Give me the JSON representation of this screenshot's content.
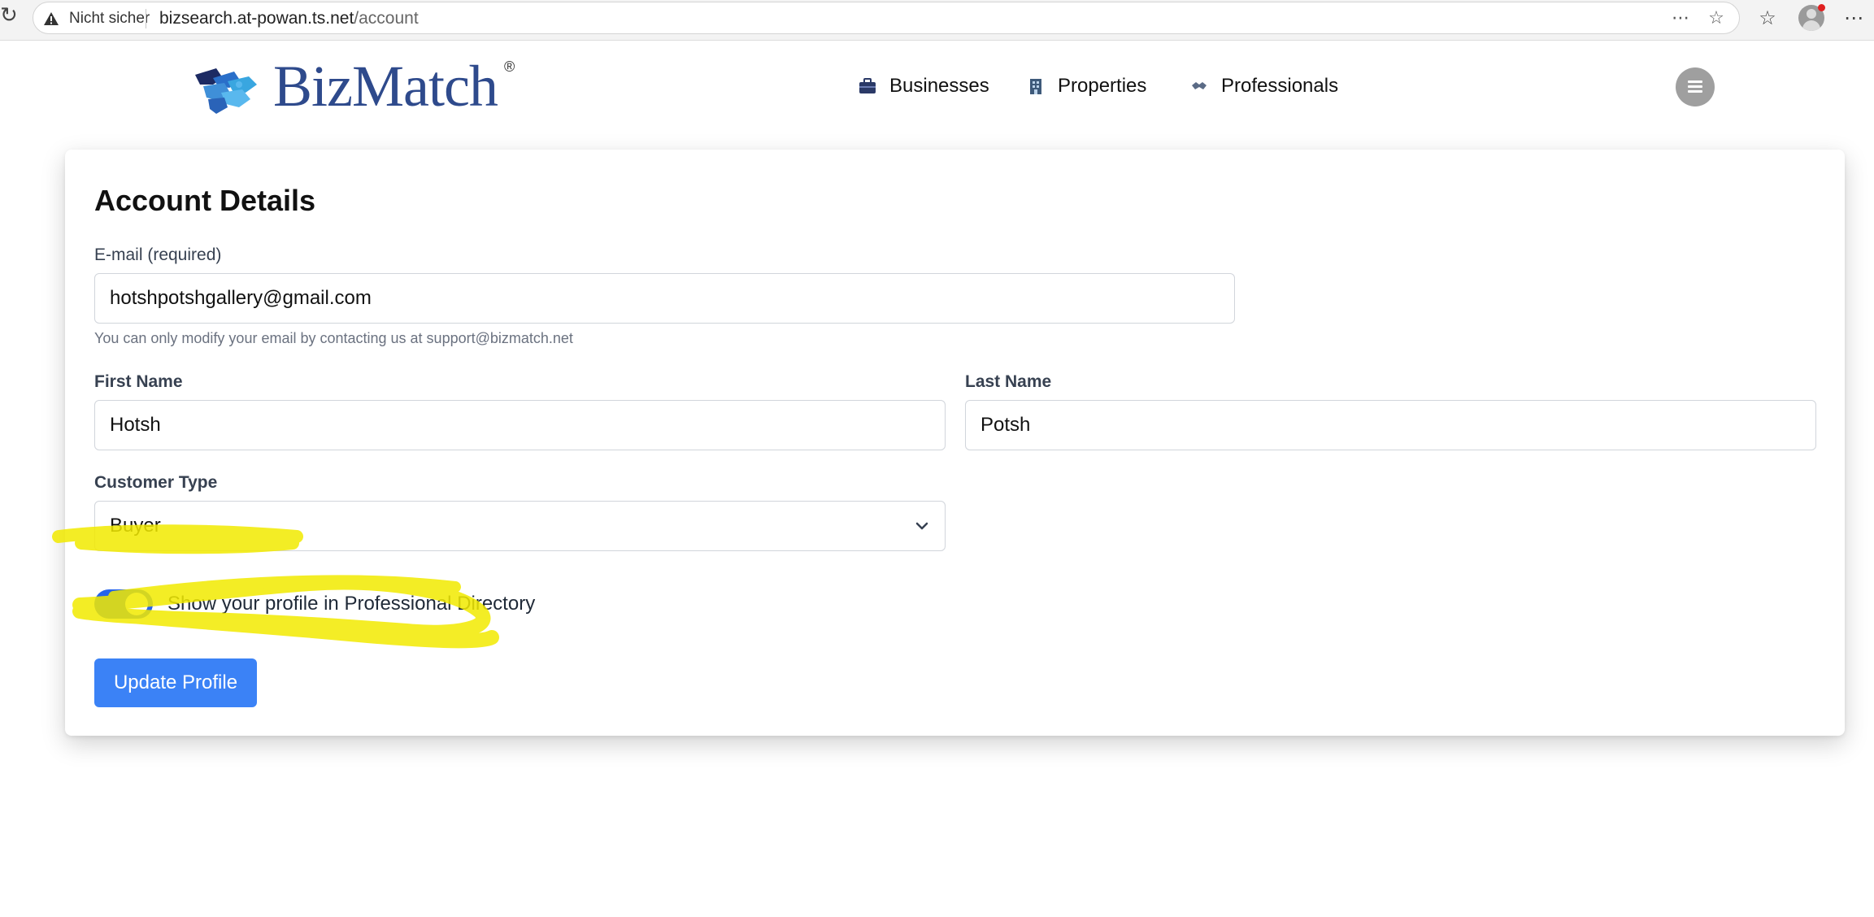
{
  "browser": {
    "security_label": "Nicht sicher",
    "url_host": "bizsearch.at-powan.ts.net",
    "url_path": "/account"
  },
  "header": {
    "logo_text": "BizMatch",
    "logo_mark": "®",
    "nav": [
      {
        "label": "Businesses",
        "icon": "briefcase-icon"
      },
      {
        "label": "Properties",
        "icon": "building-icon"
      },
      {
        "label": "Professionals",
        "icon": "handshake-icon"
      }
    ],
    "menu_icon": "hamburger-menu-icon"
  },
  "account": {
    "title": "Account Details",
    "email_label": "E-mail (required)",
    "email_value": "hotshpotshgallery@gmail.com",
    "email_help": "You can only modify your email by contacting us at support@bizmatch.net",
    "first_name_label": "First Name",
    "first_name_value": "Hotsh",
    "last_name_label": "Last Name",
    "last_name_value": "Potsh",
    "customer_type_label": "Customer Type",
    "customer_type_value": "Buyer",
    "toggle_label": "Show your profile in Professional Directory",
    "toggle_on": true,
    "update_button": "Update Profile"
  },
  "colors": {
    "primary": "#3b82f6",
    "toggle": "#2563eb",
    "highlighter": "#f2ea00",
    "logo_blue": "#2e4a8c"
  }
}
